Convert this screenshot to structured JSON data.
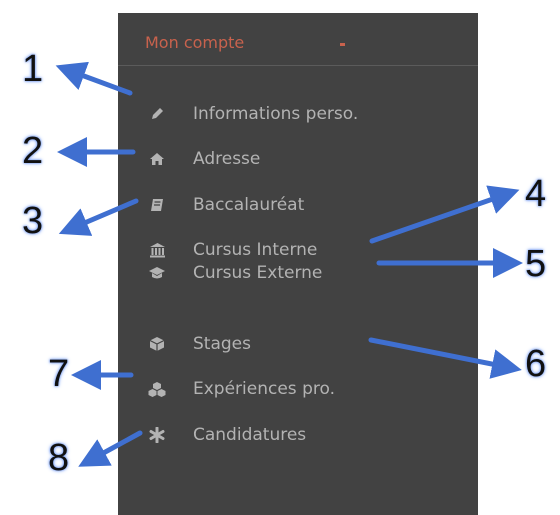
{
  "menu": {
    "title": "Mon compte",
    "items": [
      {
        "label": "Informations perso.",
        "icon": "pencil-icon"
      },
      {
        "label": "Adresse",
        "icon": "home-icon"
      },
      {
        "label": "Baccalauréat",
        "icon": "book-icon"
      },
      {
        "label": "Cursus Interne",
        "icon": "bank-icon"
      },
      {
        "label": "Cursus Externe",
        "icon": "graduation-cap-icon"
      },
      {
        "label": "Stages",
        "icon": "cube-icon"
      },
      {
        "label": "Expériences pro.",
        "icon": "cubes-icon"
      },
      {
        "label": "Candidatures",
        "icon": "asterisk-icon"
      }
    ]
  },
  "annotations": {
    "labels": [
      "1",
      "2",
      "3",
      "4",
      "5",
      "6",
      "7",
      "8"
    ]
  },
  "colors": {
    "panel_bg": "#424242",
    "title": "#c8624d",
    "item_text": "#b3b3b3",
    "arrow": "#3f6fd0"
  }
}
